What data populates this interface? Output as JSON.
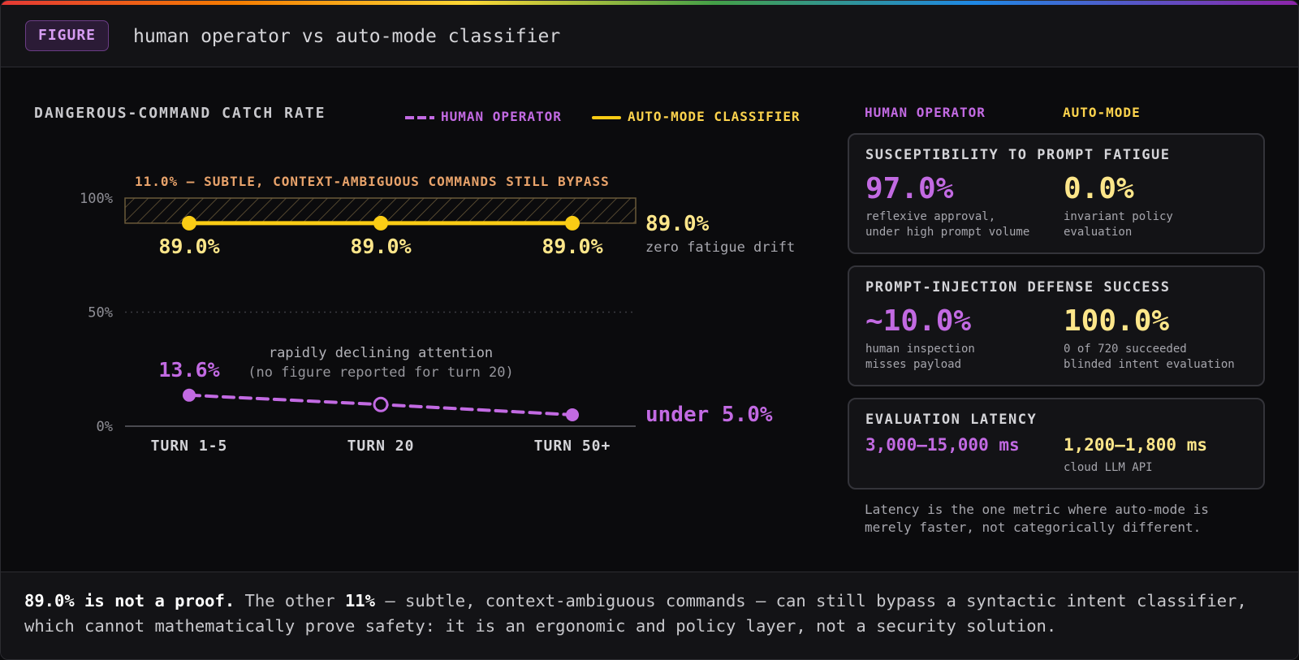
{
  "header": {
    "badge": "FIGURE",
    "title": "human operator vs auto-mode classifier"
  },
  "chart_data": {
    "type": "line",
    "title": "DANGEROUS-COMMAND CATCH RATE",
    "categories": [
      "TURN 1-5",
      "TURN 20",
      "TURN 50+"
    ],
    "ylim": [
      0,
      100
    ],
    "y_ticks": [
      "0%",
      "50%",
      "100%"
    ],
    "legend_position": "top-right",
    "series": [
      {
        "name": "HUMAN OPERATOR",
        "color": "#c26ae2",
        "style": "dashed",
        "values": [
          13.6,
          9.5,
          5.0
        ],
        "reported": [
          true,
          false,
          true
        ],
        "labels": [
          "13.6%",
          "",
          ""
        ]
      },
      {
        "name": "AUTO-MODE CLASSIFIER",
        "color": "#facc15",
        "style": "solid",
        "values": [
          89.0,
          89.0,
          89.0
        ],
        "labels": [
          "89.0%",
          "89.0%",
          "89.0%"
        ]
      }
    ],
    "band": {
      "from": 89.0,
      "to": 100,
      "label": "11.0% — SUBTLE, CONTEXT-AMBIGUOUS COMMANDS STILL BYPASS"
    },
    "annotations": {
      "human_note_1": "rapidly declining attention",
      "human_note_2": "(no figure reported for turn 20)",
      "auto_end_value": "89.0%",
      "auto_end_note": "zero fatigue drift",
      "human_end_value": "under 5.0%"
    }
  },
  "comparison": {
    "col_human": "HUMAN OPERATOR",
    "col_auto": "AUTO-MODE",
    "fatigue": {
      "title": "SUSCEPTIBILITY TO PROMPT FATIGUE",
      "human_value": "97.0%",
      "human_desc_1": "reflexive approval,",
      "human_desc_2": "under high prompt volume",
      "auto_value": "0.0%",
      "auto_desc_1": "invariant policy",
      "auto_desc_2": "evaluation"
    },
    "injection": {
      "title": "PROMPT-INJECTION DEFENSE SUCCESS",
      "human_value": "~10.0%",
      "human_desc_1": "human inspection",
      "human_desc_2": "misses payload",
      "auto_value": "100.0%",
      "auto_desc_1": "0 of 720 succeeded",
      "auto_desc_2": "blinded intent evaluation"
    },
    "latency": {
      "title": "EVALUATION LATENCY",
      "human_value": "3,000–15,000 ms",
      "auto_value": "1,200–1,800 ms",
      "auto_desc": "cloud LLM API"
    },
    "latency_note": "Latency is the one metric where auto-mode is merely faster, not categorically different."
  },
  "footer": {
    "bold_1": "89.0% is not a proof.",
    "text_1": " The other ",
    "bold_2": "11%",
    "text_2": " — subtle, context-ambiguous commands — can still bypass a syntactic intent classifier, which cannot mathematically prove safety: it is an ergonomic and policy layer, not a security solution."
  }
}
